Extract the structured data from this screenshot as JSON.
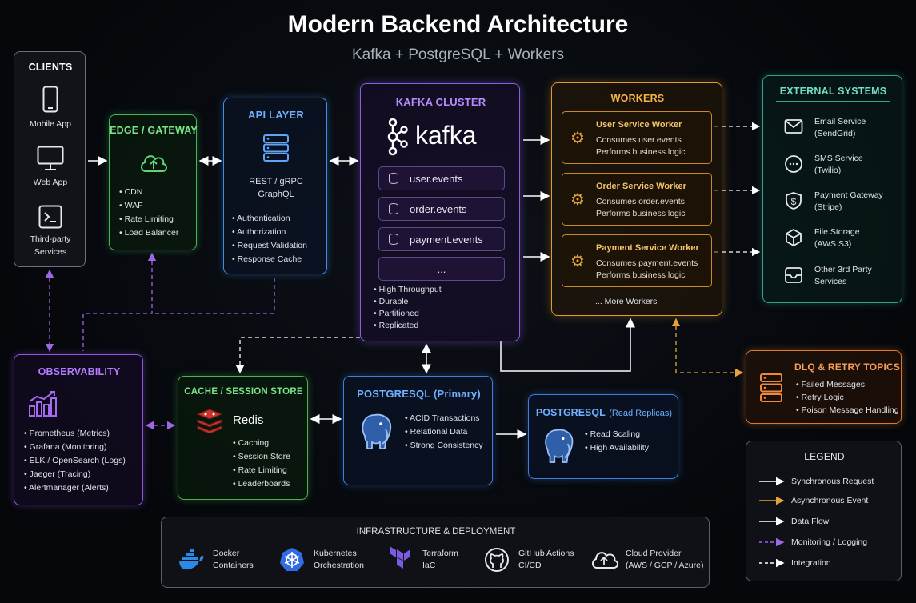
{
  "title": "Modern Backend Architecture",
  "subtitle": "Kafka + PostgreSQL + Workers",
  "clients": {
    "title": "CLIENTS",
    "items": [
      "Mobile App",
      "Web App",
      "Third-party",
      "Services"
    ]
  },
  "gateway": {
    "title": "EDGE / GATEWAY",
    "items": [
      "CDN",
      "WAF",
      "Rate Limiting",
      "Load Balancer"
    ]
  },
  "api": {
    "title": "API LAYER",
    "protocols": [
      "REST / gRPC",
      "GraphQL"
    ],
    "items": [
      "Authentication",
      "Authorization",
      "Request Validation",
      "Response Cache"
    ]
  },
  "kafka": {
    "title": "KAFKA CLUSTER",
    "logo": "kafka",
    "topics": [
      "user.events",
      "order.events",
      "payment.events",
      "..."
    ],
    "items": [
      "High Throughput",
      "Durable",
      "Partitioned",
      "Replicated"
    ]
  },
  "workers": {
    "title": "WORKERS",
    "list": [
      {
        "name": "User Service Worker",
        "l1": "Consumes user.events",
        "l2": "Performs business logic"
      },
      {
        "name": "Order Service Worker",
        "l1": "Consumes order.events",
        "l2": "Performs business logic"
      },
      {
        "name": "Payment Service Worker",
        "l1": "Consumes payment.events",
        "l2": "Performs business logic"
      }
    ],
    "more": "... More Workers"
  },
  "external": {
    "title": "EXTERNAL SYSTEMS",
    "items": [
      {
        "l1": "Email Service",
        "l2": "(SendGrid)",
        "icon": "envelope-icon"
      },
      {
        "l1": "SMS Service",
        "l2": "(Twilio)",
        "icon": "chat-icon"
      },
      {
        "l1": "Payment Gateway",
        "l2": "(Stripe)",
        "icon": "dollar-icon"
      },
      {
        "l1": "File Storage",
        "l2": "(AWS S3)",
        "icon": "box-icon"
      },
      {
        "l1": "Other 3rd Party",
        "l2": "Services",
        "icon": "tray-icon"
      }
    ]
  },
  "observability": {
    "title": "OBSERVABILITY",
    "items": [
      "Prometheus (Metrics)",
      "Grafana (Monitoring)",
      "ELK / OpenSearch (Logs)",
      "Jaeger (Tracing)",
      "Alertmanager (Alerts)"
    ]
  },
  "cache": {
    "title": "CACHE / SESSION STORE",
    "name": "Redis",
    "items": [
      "Caching",
      "Session Store",
      "Rate Limiting",
      "Leaderboards"
    ]
  },
  "pg_primary": {
    "title": "POSTGRESQL (Primary)",
    "items": [
      "ACID Transactions",
      "Relational Data",
      "Strong Consistency"
    ]
  },
  "pg_replicas": {
    "title_a": "POSTGRESQL",
    "title_b": "(Read Replicas)",
    "items": [
      "Read Scaling",
      "High Availability"
    ]
  },
  "dlq": {
    "title": "DLQ & RETRY TOPICS",
    "items": [
      "Failed Messages",
      "Retry Logic",
      "Poison Message Handling"
    ]
  },
  "legend": {
    "title": "LEGEND",
    "items": [
      {
        "label": "Synchronous Request",
        "color": "#ffffff",
        "style": "solid"
      },
      {
        "label": "Asynchronous Event",
        "color": "#e8a23a",
        "style": "solid"
      },
      {
        "label": "Data Flow",
        "color": "#ffffff",
        "style": "solid"
      },
      {
        "label": "Monitoring / Logging",
        "color": "#a066e6",
        "style": "dashed"
      },
      {
        "label": "Integration",
        "color": "#ffffff",
        "style": "dashed"
      }
    ]
  },
  "infra": {
    "title": "INFRASTRUCTURE & DEPLOYMENT",
    "items": [
      {
        "l1": "Docker",
        "l2": "Containers",
        "icon": "docker-icon"
      },
      {
        "l1": "Kubernetes",
        "l2": "Orchestration",
        "icon": "kubernetes-icon"
      },
      {
        "l1": "Terraform",
        "l2": "IaC",
        "icon": "terraform-icon"
      },
      {
        "l1": "GitHub Actions",
        "l2": "CI/CD",
        "icon": "github-icon"
      },
      {
        "l1": "Cloud Provider",
        "l2": "(AWS / GCP / Azure)",
        "icon": "cloud-icon"
      }
    ]
  }
}
